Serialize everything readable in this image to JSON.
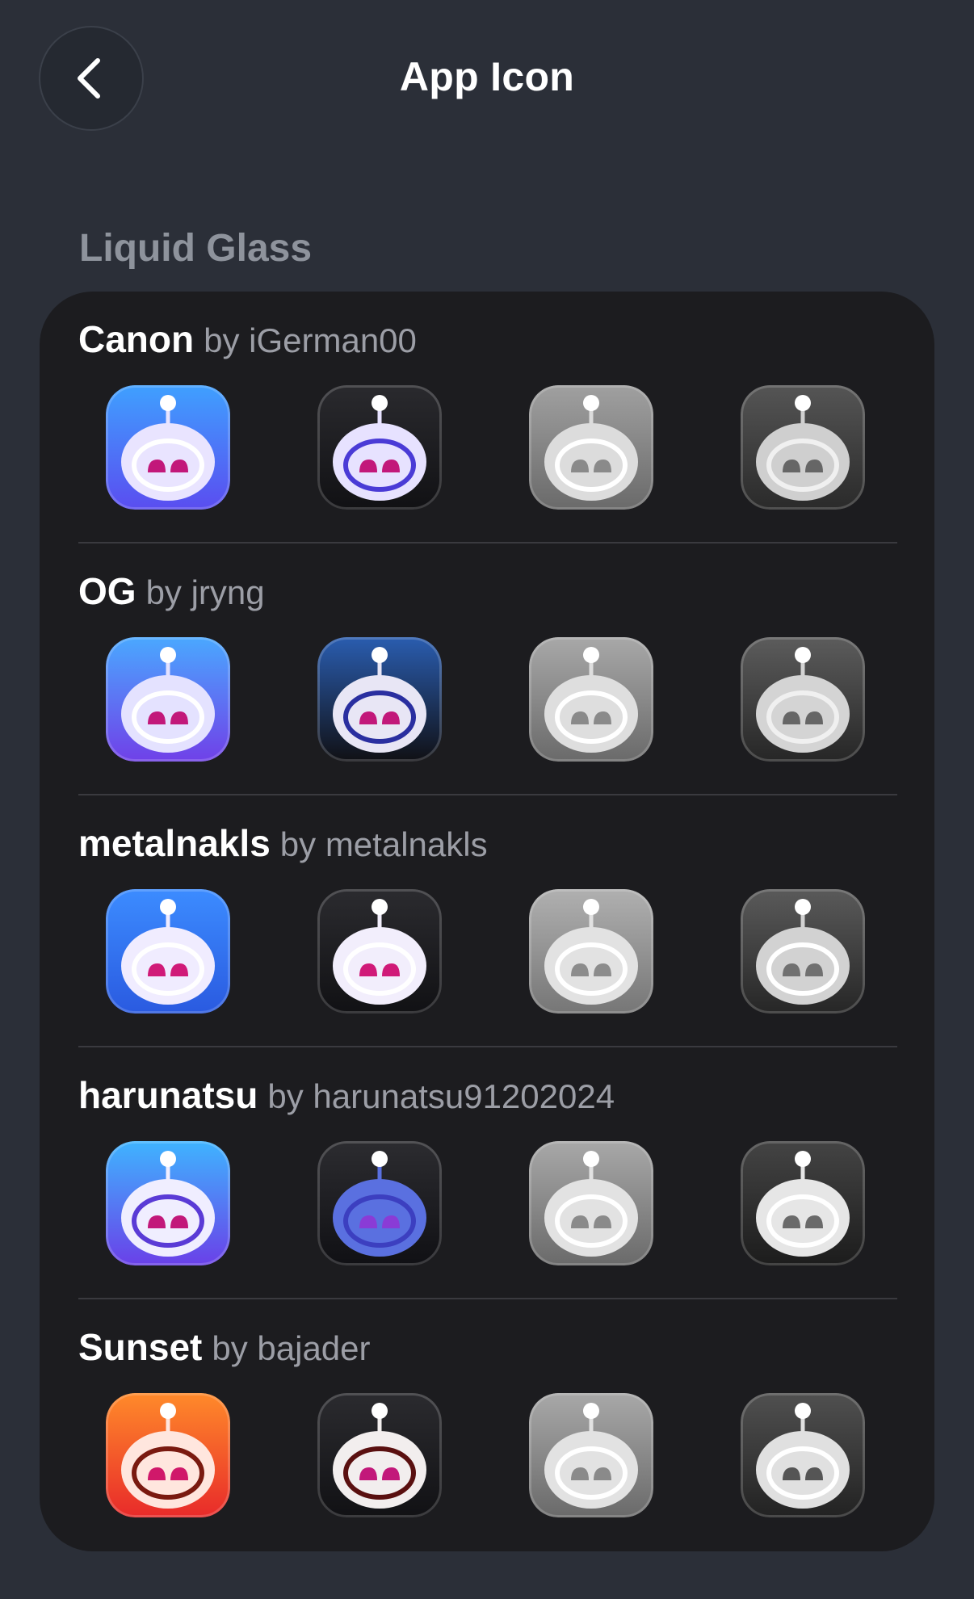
{
  "nav": {
    "title": "App Icon"
  },
  "section": {
    "header": "Liquid Glass"
  },
  "rows": [
    {
      "name": "Canon",
      "by": "by iGerman00",
      "icons": [
        {
          "bg": [
            "#3fa0ff",
            "#5a4df0"
          ],
          "face": "#e9e4ff",
          "ring": "#ffffff",
          "eyes": "#c2187a"
        },
        {
          "bg": [
            "#2a2a2e",
            "#111114"
          ],
          "face": "#e7e2ff",
          "ring": "#4a3bd6",
          "eyes": "#c2187a"
        },
        {
          "bg": [
            "#a0a0a0",
            "#6a6a6a"
          ],
          "face": "#dcdcdc",
          "ring": "#ffffff",
          "eyes": "#8a8a8a"
        },
        {
          "bg": [
            "#555555",
            "#2a2a2a"
          ],
          "face": "#cfcfcf",
          "ring": "#f0f0f0",
          "eyes": "#666666"
        }
      ]
    },
    {
      "name": "OG",
      "by": "by jryng",
      "icons": [
        {
          "bg": [
            "#4aa8ff",
            "#7040e8"
          ],
          "face": "#e4e2ff",
          "ring": "#ffffff",
          "eyes": "#c2187a"
        },
        {
          "bg": [
            "#2a5db0",
            "#101014"
          ],
          "face": "#e8e6f5",
          "ring": "#2a2fa0",
          "eyes": "#c2187a"
        },
        {
          "bg": [
            "#a8a8a8",
            "#6a6a6a"
          ],
          "face": "#dedede",
          "ring": "#ffffff",
          "eyes": "#8a8a8a"
        },
        {
          "bg": [
            "#5c5c5c",
            "#262626"
          ],
          "face": "#d4d4d4",
          "ring": "#f0f0f0",
          "eyes": "#666666"
        }
      ]
    },
    {
      "name": "metalnakls",
      "by": "by metalnakls",
      "icons": [
        {
          "bg": [
            "#3c8cff",
            "#2a5ae0"
          ],
          "face": "#f0ecff",
          "ring": "#ffffff",
          "eyes": "#d01a78"
        },
        {
          "bg": [
            "#2b2b2f",
            "#111114"
          ],
          "face": "#f2eefc",
          "ring": "#ffffff",
          "eyes": "#d01a78"
        },
        {
          "bg": [
            "#b0b0b0",
            "#767676"
          ],
          "face": "#e2e2e2",
          "ring": "#ffffff",
          "eyes": "#8c8c8c"
        },
        {
          "bg": [
            "#5a5a5a",
            "#262626"
          ],
          "face": "#d2d2d2",
          "ring": "#ffffff",
          "eyes": "#707070"
        }
      ]
    },
    {
      "name": "harunatsu",
      "by": "by harunatsu91202024",
      "icons": [
        {
          "bg": [
            "#3fb4ff",
            "#6a40e8"
          ],
          "face": "#f0eeff",
          "ring": "#5a3bd6",
          "eyes": "#c2187a"
        },
        {
          "bg": [
            "#2c2c30",
            "#101014"
          ],
          "face": "#5a70e0",
          "ring": "#3c3fc0",
          "eyes": "#8a3bd6"
        },
        {
          "bg": [
            "#a8a8a8",
            "#6a6a6a"
          ],
          "face": "#e2e2e2",
          "ring": "#ffffff",
          "eyes": "#8a8a8a"
        },
        {
          "bg": [
            "#444444",
            "#1c1c1c"
          ],
          "face": "#e6e6e6",
          "ring": "#ffffff",
          "eyes": "#6a6a6a"
        }
      ]
    },
    {
      "name": "Sunset",
      "by": "by bajader",
      "icons": [
        {
          "bg": [
            "#ff8a2a",
            "#e82a2a"
          ],
          "face": "#ffe6de",
          "ring": "#7a1a10",
          "eyes": "#d0186a"
        },
        {
          "bg": [
            "#2b2b2f",
            "#111114"
          ],
          "face": "#f2eeee",
          "ring": "#5a1010",
          "eyes": "#c2187a"
        },
        {
          "bg": [
            "#a8a8a8",
            "#6a6a6a"
          ],
          "face": "#e2e2e2",
          "ring": "#ffffff",
          "eyes": "#8a8a8a"
        },
        {
          "bg": [
            "#505050",
            "#222222"
          ],
          "face": "#e0e0e0",
          "ring": "#ffffff",
          "eyes": "#555555"
        }
      ]
    }
  ]
}
